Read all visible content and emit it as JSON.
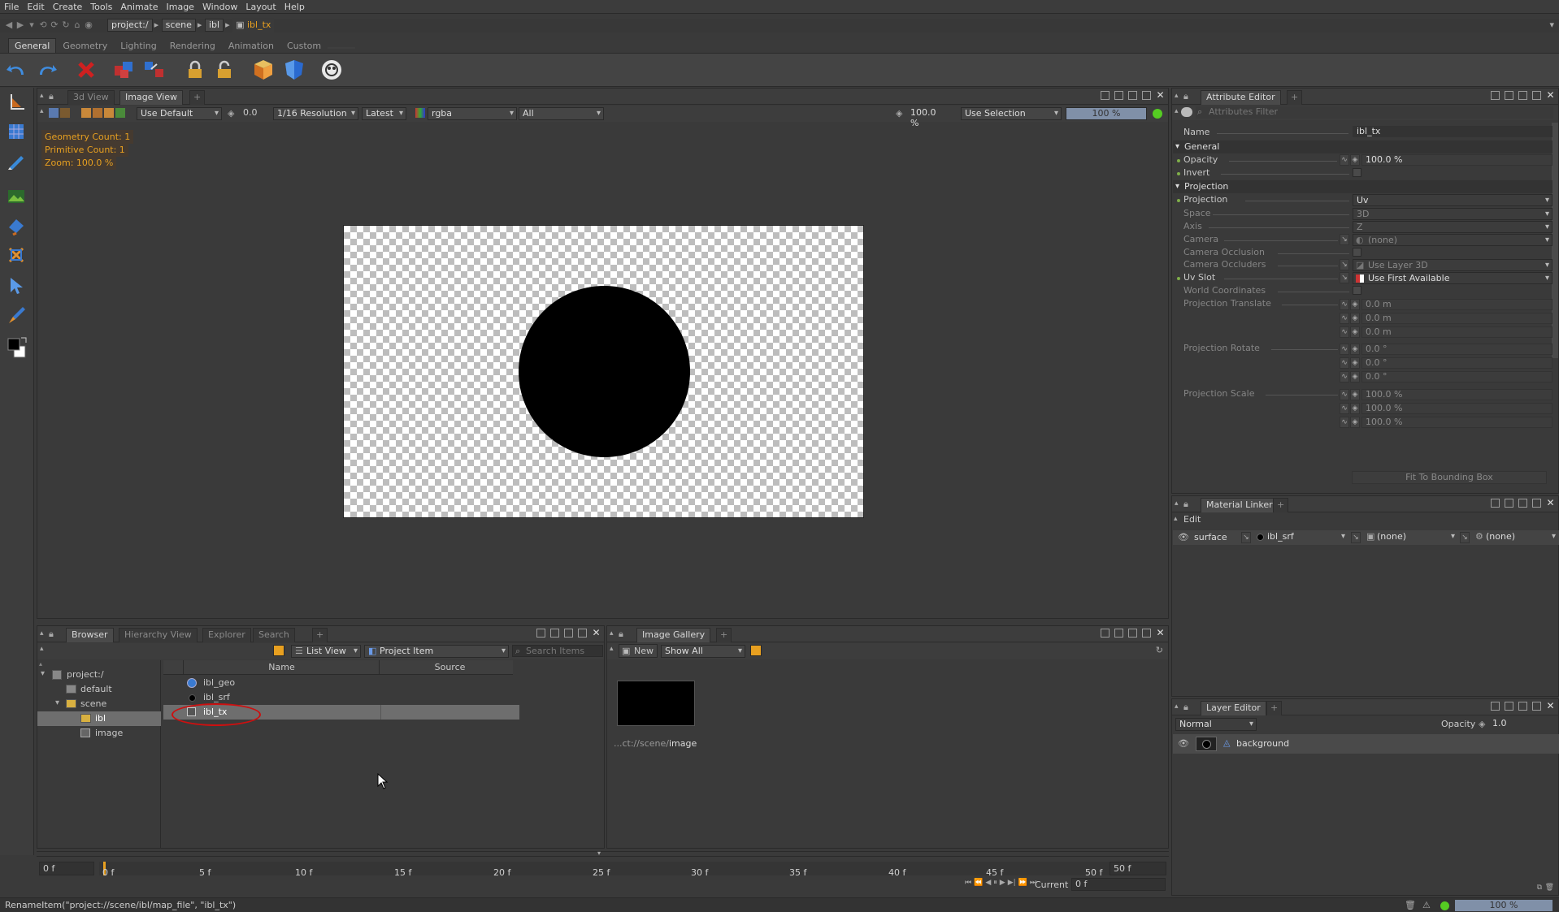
{
  "menu": [
    "File",
    "Edit",
    "Create",
    "Tools",
    "Animate",
    "Image",
    "Window",
    "Layout",
    "Help"
  ],
  "path": [
    "project:/",
    "scene",
    "ibl",
    "ibl_tx"
  ],
  "shelf_tabs": [
    "General",
    "Geometry",
    "Lighting",
    "Rendering",
    "Animation",
    "Custom"
  ],
  "viewport": {
    "tabs": [
      "3d View",
      "Image View"
    ],
    "toolbar": {
      "preset": "Use Default",
      "exposure": "0.0",
      "resolution": "1/16 Resolution",
      "version": "Latest",
      "channel": "rgba",
      "layer": "All",
      "zoom": "100.0 %",
      "selection": "Use Selection",
      "progress": "100 %"
    },
    "overlay": [
      "Geometry Count: 1",
      "Primitive Count: 1",
      "Zoom: 100.0 %"
    ]
  },
  "attribute_editor": {
    "title": "Attribute Editor",
    "filter_placeholder": "Attributes Filter",
    "name_label": "Name",
    "name_value": "ibl_tx",
    "general_section": "General",
    "opacity_label": "Opacity",
    "opacity_value": "100.0 %",
    "invert_label": "Invert",
    "projection_section": "Projection",
    "projection_label": "Projection",
    "projection_value": "Uv",
    "space_label": "Space",
    "space_value": "3D",
    "axis_label": "Axis",
    "axis_value": "Z",
    "camera_label": "Camera",
    "camera_value": "(none)",
    "camera_occlusion_label": "Camera Occlusion",
    "camera_occluders_label": "Camera Occluders",
    "camera_occluders_value": "Use Layer 3D",
    "uv_slot_label": "Uv Slot",
    "uv_slot_value": "Use First Available",
    "world_coords_label": "World Coordinates",
    "proj_translate_label": "Projection Translate",
    "proj_translate": [
      "0.0 m",
      "0.0 m",
      "0.0 m"
    ],
    "proj_rotate_label": "Projection Rotate",
    "proj_rotate": [
      "0.0 °",
      "0.0 °",
      "0.0 °"
    ],
    "proj_scale_label": "Projection Scale",
    "proj_scale": [
      "100.0 %",
      "100.0 %",
      "100.0 %"
    ],
    "fit_button": "Fit To Bounding Box"
  },
  "material_linker": {
    "title": "Material Linker",
    "edit_label": "Edit",
    "surface_label": "surface",
    "material": "ibl_srf",
    "slot2": "(none)",
    "slot3": "(none)"
  },
  "layer_editor": {
    "title": "Layer Editor",
    "blend_mode": "Normal",
    "opacity_label": "Opacity",
    "opacity_value": "1.0",
    "layer_name": "background"
  },
  "browser": {
    "tabs": [
      "Browser",
      "Hierarchy View",
      "Explorer",
      "Search"
    ],
    "view_mode": "List View",
    "filter": "Project Item",
    "search_placeholder": "Search Items",
    "tree": [
      {
        "label": "project:/",
        "depth": 0
      },
      {
        "label": "default",
        "depth": 1
      },
      {
        "label": "scene",
        "depth": 1
      },
      {
        "label": "ibl",
        "depth": 2
      },
      {
        "label": "image",
        "depth": 2
      }
    ],
    "columns": [
      "Name",
      "Source"
    ],
    "items": [
      "ibl_geo",
      "ibl_srf",
      "ibl_tx"
    ]
  },
  "gallery": {
    "title": "Image Gallery",
    "new_label": "New",
    "show": "Show All",
    "caption_prefix": "...ct://scene/",
    "caption_name": "image"
  },
  "timeline": {
    "start_field": "0 f",
    "end_field": "50 f",
    "ticks": [
      "0 f",
      "5 f",
      "10 f",
      "15 f",
      "20 f",
      "25 f",
      "30 f",
      "35 f",
      "40 f",
      "45 f",
      "50 f"
    ],
    "current_label": "Current",
    "current_value": "0 f"
  },
  "status": {
    "message": "RenameItem(\"project://scene/ibl/map_file\", \"ibl_tx\")",
    "zoom": "100 %"
  },
  "colors": {
    "accent": "#e8a020",
    "selection": "#6e6e6e",
    "ok_green": "#55cc22"
  }
}
